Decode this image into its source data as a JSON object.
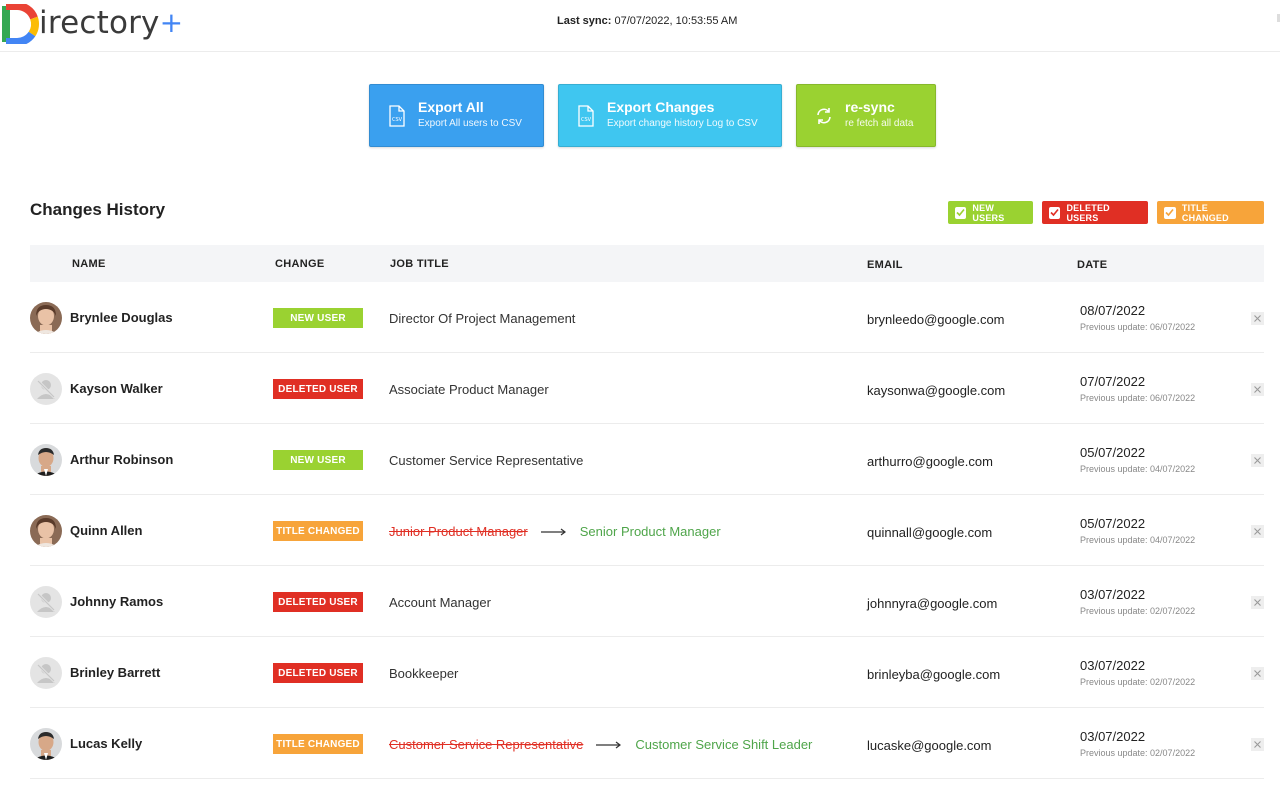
{
  "app": {
    "logo_text": "irectory",
    "logo_plus": "+",
    "last_sync_label": "Last sync:",
    "last_sync_value": "07/07/2022, 10:53:55 AM"
  },
  "actions": [
    {
      "title": "Export All",
      "subtitle": "Export All users to CSV",
      "icon": "csv-file-icon",
      "color": "#3aa0ef"
    },
    {
      "title": "Export Changes",
      "subtitle": "Export change history Log to CSV",
      "icon": "csv-file-icon",
      "color": "#3fc6f0"
    },
    {
      "title": "re-sync",
      "subtitle": "re fetch all data",
      "icon": "sync-icon",
      "color": "#9ad231"
    }
  ],
  "section_title": "Changes History",
  "filters": [
    {
      "label": "NEW USERS",
      "checked": true,
      "color": "#9ad231"
    },
    {
      "label": "DELETED USERS",
      "checked": true,
      "color": "#e02f24"
    },
    {
      "label": "TITLE CHANGED",
      "checked": true,
      "color": "#f7a43a"
    }
  ],
  "table": {
    "headers": {
      "name": "NAME",
      "change": "CHANGE",
      "job_title": "JOB TITLE",
      "email": "EMAIL",
      "date": "DATE"
    },
    "rows": [
      {
        "name": "Brynlee Douglas",
        "avatar": "photo-female",
        "change": "NEW USER",
        "change_type": "new",
        "job_title": "Director Of Project Management",
        "email": "brynleedo@google.com",
        "date": "08/07/2022",
        "previous": "Previous update: 06/07/2022"
      },
      {
        "name": "Kayson Walker",
        "avatar": "placeholder-user",
        "change": "DELETED USER",
        "change_type": "deleted",
        "job_title": "Associate Product Manager",
        "email": "kaysonwa@google.com",
        "date": "07/07/2022",
        "previous": "Previous update: 06/07/2022"
      },
      {
        "name": "Arthur Robinson",
        "avatar": "photo-male",
        "change": "NEW USER",
        "change_type": "new",
        "job_title": "Customer Service Representative",
        "email": "arthurro@google.com",
        "date": "05/07/2022",
        "previous": "Previous update: 04/07/2022"
      },
      {
        "name": "Quinn Allen",
        "avatar": "photo-female",
        "change": "TITLE CHANGED",
        "change_type": "title",
        "old_title": "Junior Product Manager",
        "new_title": "Senior Product Manager",
        "email": "quinnall@google.com",
        "date": "05/07/2022",
        "previous": "Previous update: 04/07/2022"
      },
      {
        "name": "Johnny Ramos",
        "avatar": "placeholder-user",
        "change": "DELETED USER",
        "change_type": "deleted",
        "job_title": "Account Manager",
        "email": "johnnyra@google.com",
        "date": "03/07/2022",
        "previous": "Previous update: 02/07/2022"
      },
      {
        "name": "Brinley Barrett",
        "avatar": "placeholder-user",
        "change": "DELETED USER",
        "change_type": "deleted",
        "job_title": "Bookkeeper",
        "email": "brinleyba@google.com",
        "date": "03/07/2022",
        "previous": "Previous update: 02/07/2022"
      },
      {
        "name": "Lucas Kelly",
        "avatar": "photo-male",
        "change": "TITLE CHANGED",
        "change_type": "title",
        "old_title": "Customer Service Representative",
        "new_title": "Customer Service Shift Leader",
        "email": "lucaske@google.com",
        "date": "03/07/2022",
        "previous": "Previous update: 02/07/2022"
      }
    ]
  }
}
